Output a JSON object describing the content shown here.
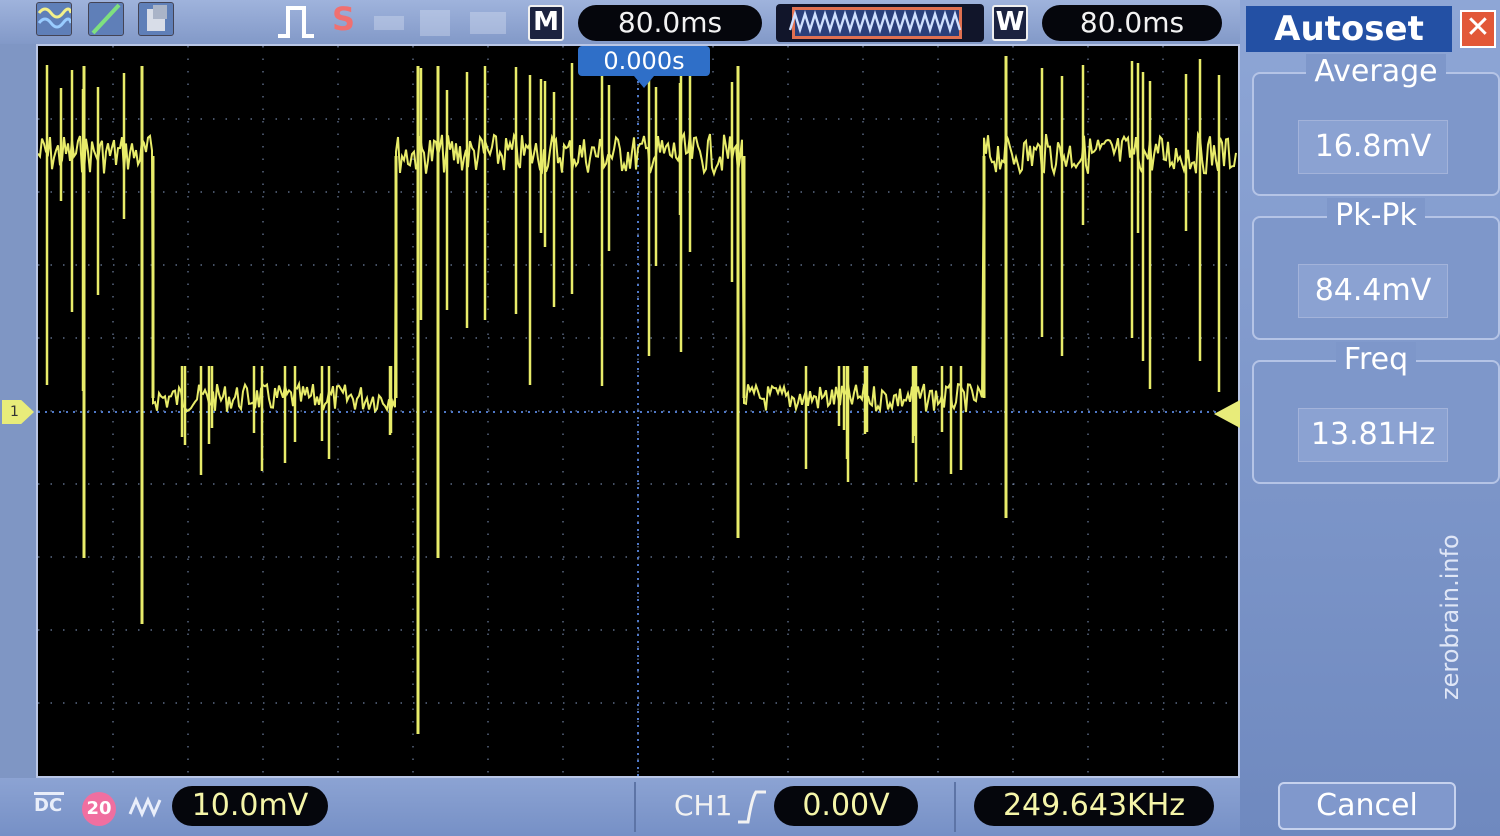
{
  "top": {
    "mode_label": "M",
    "main_timebase": "80.0ms",
    "window_label": "W",
    "window_timebase": "80.0ms",
    "status_letter": "S"
  },
  "screen": {
    "trigger_time": "0.000s",
    "channel_marker": "1",
    "trace_color": "#e8ec6a",
    "grid_color": "#8aa0c8"
  },
  "panel": {
    "title": "Autoset",
    "close": "✕",
    "measurements": [
      {
        "label": "Average",
        "value": "16.8mV"
      },
      {
        "label": "Pk-Pk",
        "value": "84.4mV"
      },
      {
        "label": "Freq",
        "value": "13.81Hz"
      }
    ],
    "cancel": "Cancel",
    "watermark": "zerobrain.info"
  },
  "bottom": {
    "coupling": "DC",
    "bw_limit": "20",
    "volts_per_div": "10.0mV",
    "trigger_source": "CH1",
    "trigger_level": "0.00V",
    "frequency": "249.643KHz"
  },
  "colors": {
    "accent": "#2f6fc8",
    "trace": "#e8ec6a",
    "panel_bg": "#7e97ca"
  }
}
